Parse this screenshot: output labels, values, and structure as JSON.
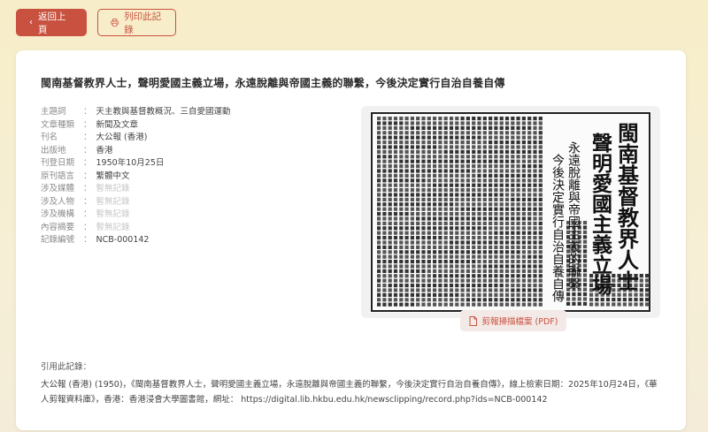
{
  "toolbar": {
    "back_label": "返回上頁",
    "print_label": "列印此記錄"
  },
  "record": {
    "title": "閩南基督教界人士，聲明愛國主義立場，永遠脫離與帝國主義的聯繫，今後決定實行自治自養自傳",
    "meta": [
      {
        "label": "主題詞",
        "value": "天主教與基督教概況、三自愛國運動",
        "faded": false
      },
      {
        "label": "文章種類",
        "value": "新聞及文章",
        "faded": false
      },
      {
        "label": "刊名",
        "value": "大公報 (香港)",
        "faded": false
      },
      {
        "label": "出版地",
        "value": "香港",
        "faded": false
      },
      {
        "label": "刊登日期",
        "value": "1950年10月25日",
        "faded": false
      },
      {
        "label": "原刊語言",
        "value": "繁體中文",
        "faded": false
      },
      {
        "label": "涉及媒體",
        "value": "暫無記錄",
        "faded": true
      },
      {
        "label": "涉及人物",
        "value": "暫無記錄",
        "faded": true
      },
      {
        "label": "涉及機構",
        "value": "暫無記錄",
        "faded": true
      },
      {
        "label": "內容摘要",
        "value": "暫無記錄",
        "faded": true
      },
      {
        "label": "記錄編號",
        "value": "NCB-000142",
        "faded": false
      }
    ],
    "clipping": {
      "headline_col1": "閩南基督教界人士",
      "headline_col2": "聲明愛國主義立場",
      "sub_col1": "今後決定實行自治自養自傳",
      "sub_col2": "永遠脫離與帝國主義的聯繫"
    },
    "pdf_label": "剪報掃描檔案 (PDF)"
  },
  "citation": {
    "label": "引用此記錄：",
    "text": "大公報 (香港) (1950)，《閩南基督教界人士，聲明愛國主義立場，永遠脫離與帝國主義的聯繫，今後決定實行自治自養自傳》，線上檢索日期：2025年10月24日，《華人剪報資料庫》，香港：香港浸會大學圖書館，網址： https://digital.lib.hkbu.edu.hk/newsclipping/record.php?ids=NCB-000142"
  },
  "colors": {
    "accent": "#c9513f",
    "background": "#f7edc8"
  }
}
